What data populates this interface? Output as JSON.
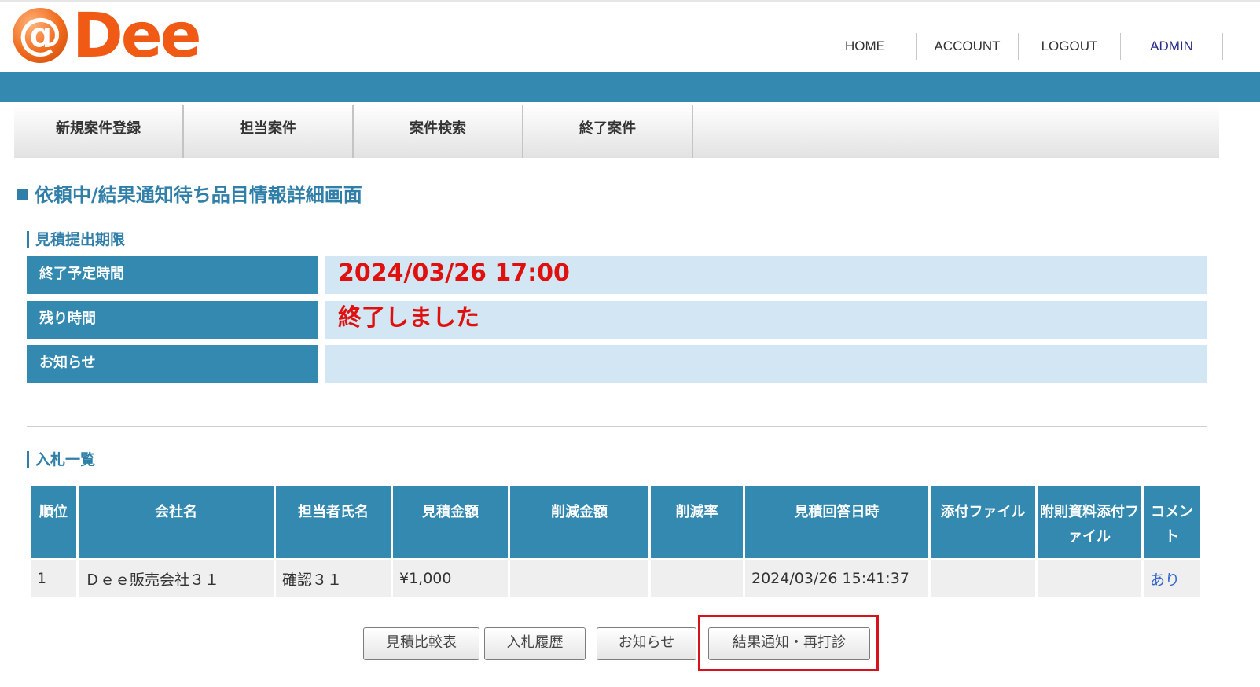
{
  "logo": {
    "at": "@",
    "text": "Dee"
  },
  "topnav": {
    "home": "HOME",
    "account": "ACCOUNT",
    "logout": "LOGOUT",
    "admin": "ADMIN"
  },
  "menu": [
    "新規案件登録",
    "担当案件",
    "案件検索",
    "終了案件"
  ],
  "page_title": "依頼中/結果通知待ち品目情報詳細画面",
  "deadline_section": {
    "label": "見積提出期限",
    "rows": [
      {
        "label": "終了予定時間",
        "value": "2024/03/26 17:00"
      },
      {
        "label": "残り時間",
        "value": "終了しました"
      },
      {
        "label": "お知らせ",
        "value": ""
      }
    ]
  },
  "bids_section": {
    "label": "入札一覧",
    "headers": [
      "順位",
      "会社名",
      "担当者氏名",
      "見積金額",
      "削減金額",
      "削減率",
      "見積回答日時",
      "添付ファイル",
      "附則資料添付ファイル",
      "コメント"
    ],
    "rows": [
      [
        "1",
        "Ｄｅｅ販売会社３１",
        "確認３１",
        "¥1,000",
        "",
        "",
        "2024/03/26 15:41:37",
        "",
        "",
        "あり"
      ]
    ]
  },
  "buttons": {
    "compare": "見積比較表",
    "history": "入札履歴",
    "notice": "お知らせ",
    "result": "結果通知・再打診"
  },
  "colors": {
    "brand_blue": "#3389b0",
    "light_blue": "#d2e6f3",
    "alert_red": "#e0100e",
    "logo_orange": "#f05a14",
    "highlight_red": "#d7121d"
  }
}
